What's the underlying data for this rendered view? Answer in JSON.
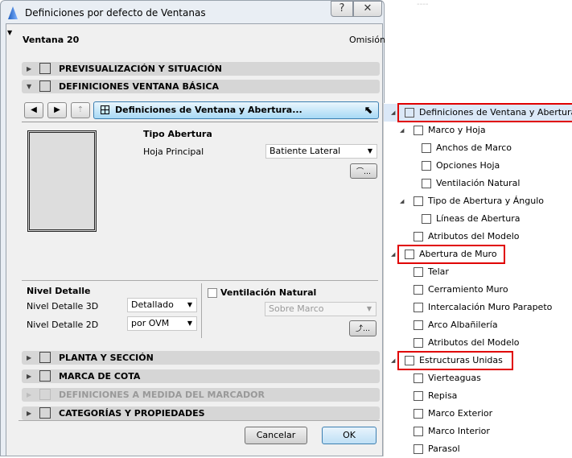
{
  "window": {
    "title": "Definiciones por defecto de Ventanas",
    "help_label": "?",
    "close_label": "✕"
  },
  "header": {
    "object_name": "Ventana 20",
    "default_label": "Omisión"
  },
  "sections": [
    {
      "label": "PREVISUALIZACIÓN Y SITUACIÓN",
      "expanded": false,
      "enabled": true
    },
    {
      "label": "DEFINICIONES VENTANA BÁSICA",
      "expanded": true,
      "enabled": true
    },
    {
      "label": "PLANTA Y SECCIÓN",
      "expanded": false,
      "enabled": true
    },
    {
      "label": "MARCA DE COTA",
      "expanded": false,
      "enabled": true
    },
    {
      "label": "DEFINICIONES A MEDIDA DEL MARCADOR",
      "expanded": false,
      "enabled": false
    },
    {
      "label": "CATEGORÍAS Y PROPIEDADES",
      "expanded": false,
      "enabled": true
    }
  ],
  "page_selector": {
    "value": "Definiciones de Ventana y Abertura..."
  },
  "opening": {
    "heading": "Tipo Abertura",
    "leaf_label": "Hoja Principal",
    "leaf_value": "Batiente Lateral"
  },
  "detail": {
    "heading": "Nivel Detalle",
    "label_3d": "Nivel Detalle 3D",
    "value_3d": "Detallado",
    "label_2d": "Nivel Detalle 2D",
    "value_2d": "por OVM"
  },
  "ventilation": {
    "label": "Ventilación Natural",
    "checked": false,
    "value": "Sobre Marco"
  },
  "buttons": {
    "cancel": "Cancelar",
    "ok": "OK"
  },
  "tree": [
    {
      "label": "Definiciones de Ventana y Abertura",
      "level": 0,
      "expanded": true,
      "selected": true,
      "highlighted": true
    },
    {
      "label": "Marco y Hoja",
      "level": 1,
      "expanded": true
    },
    {
      "label": "Anchos de Marco",
      "level": 2
    },
    {
      "label": "Opciones Hoja",
      "level": 2
    },
    {
      "label": "Ventilación Natural",
      "level": 2
    },
    {
      "label": "Tipo de Abertura y Ángulo",
      "level": 1,
      "expanded": true
    },
    {
      "label": "Líneas de Abertura",
      "level": 2
    },
    {
      "label": "Atributos del Modelo",
      "level": 1
    },
    {
      "label": "Abertura de Muro",
      "level": 0,
      "expanded": true,
      "highlighted": true
    },
    {
      "label": "Telar",
      "level": 1
    },
    {
      "label": "Cerramiento Muro",
      "level": 1
    },
    {
      "label": "Intercalación Muro Parapeto",
      "level": 1
    },
    {
      "label": "Arco Albañilería",
      "level": 1
    },
    {
      "label": "Atributos del Modelo",
      "level": 1
    },
    {
      "label": "Estructuras Unidas",
      "level": 0,
      "expanded": true,
      "highlighted": true
    },
    {
      "label": "Vierteaguas",
      "level": 1
    },
    {
      "label": "Repisa",
      "level": 1
    },
    {
      "label": "Marco Exterior",
      "level": 1
    },
    {
      "label": "Marco Interior",
      "level": 1
    },
    {
      "label": "Parasol",
      "level": 1
    }
  ],
  "colors": {
    "highlight_box": "#e00000",
    "selected_row": "#dbe8f7",
    "ok_accent": "#3c7fb1"
  }
}
